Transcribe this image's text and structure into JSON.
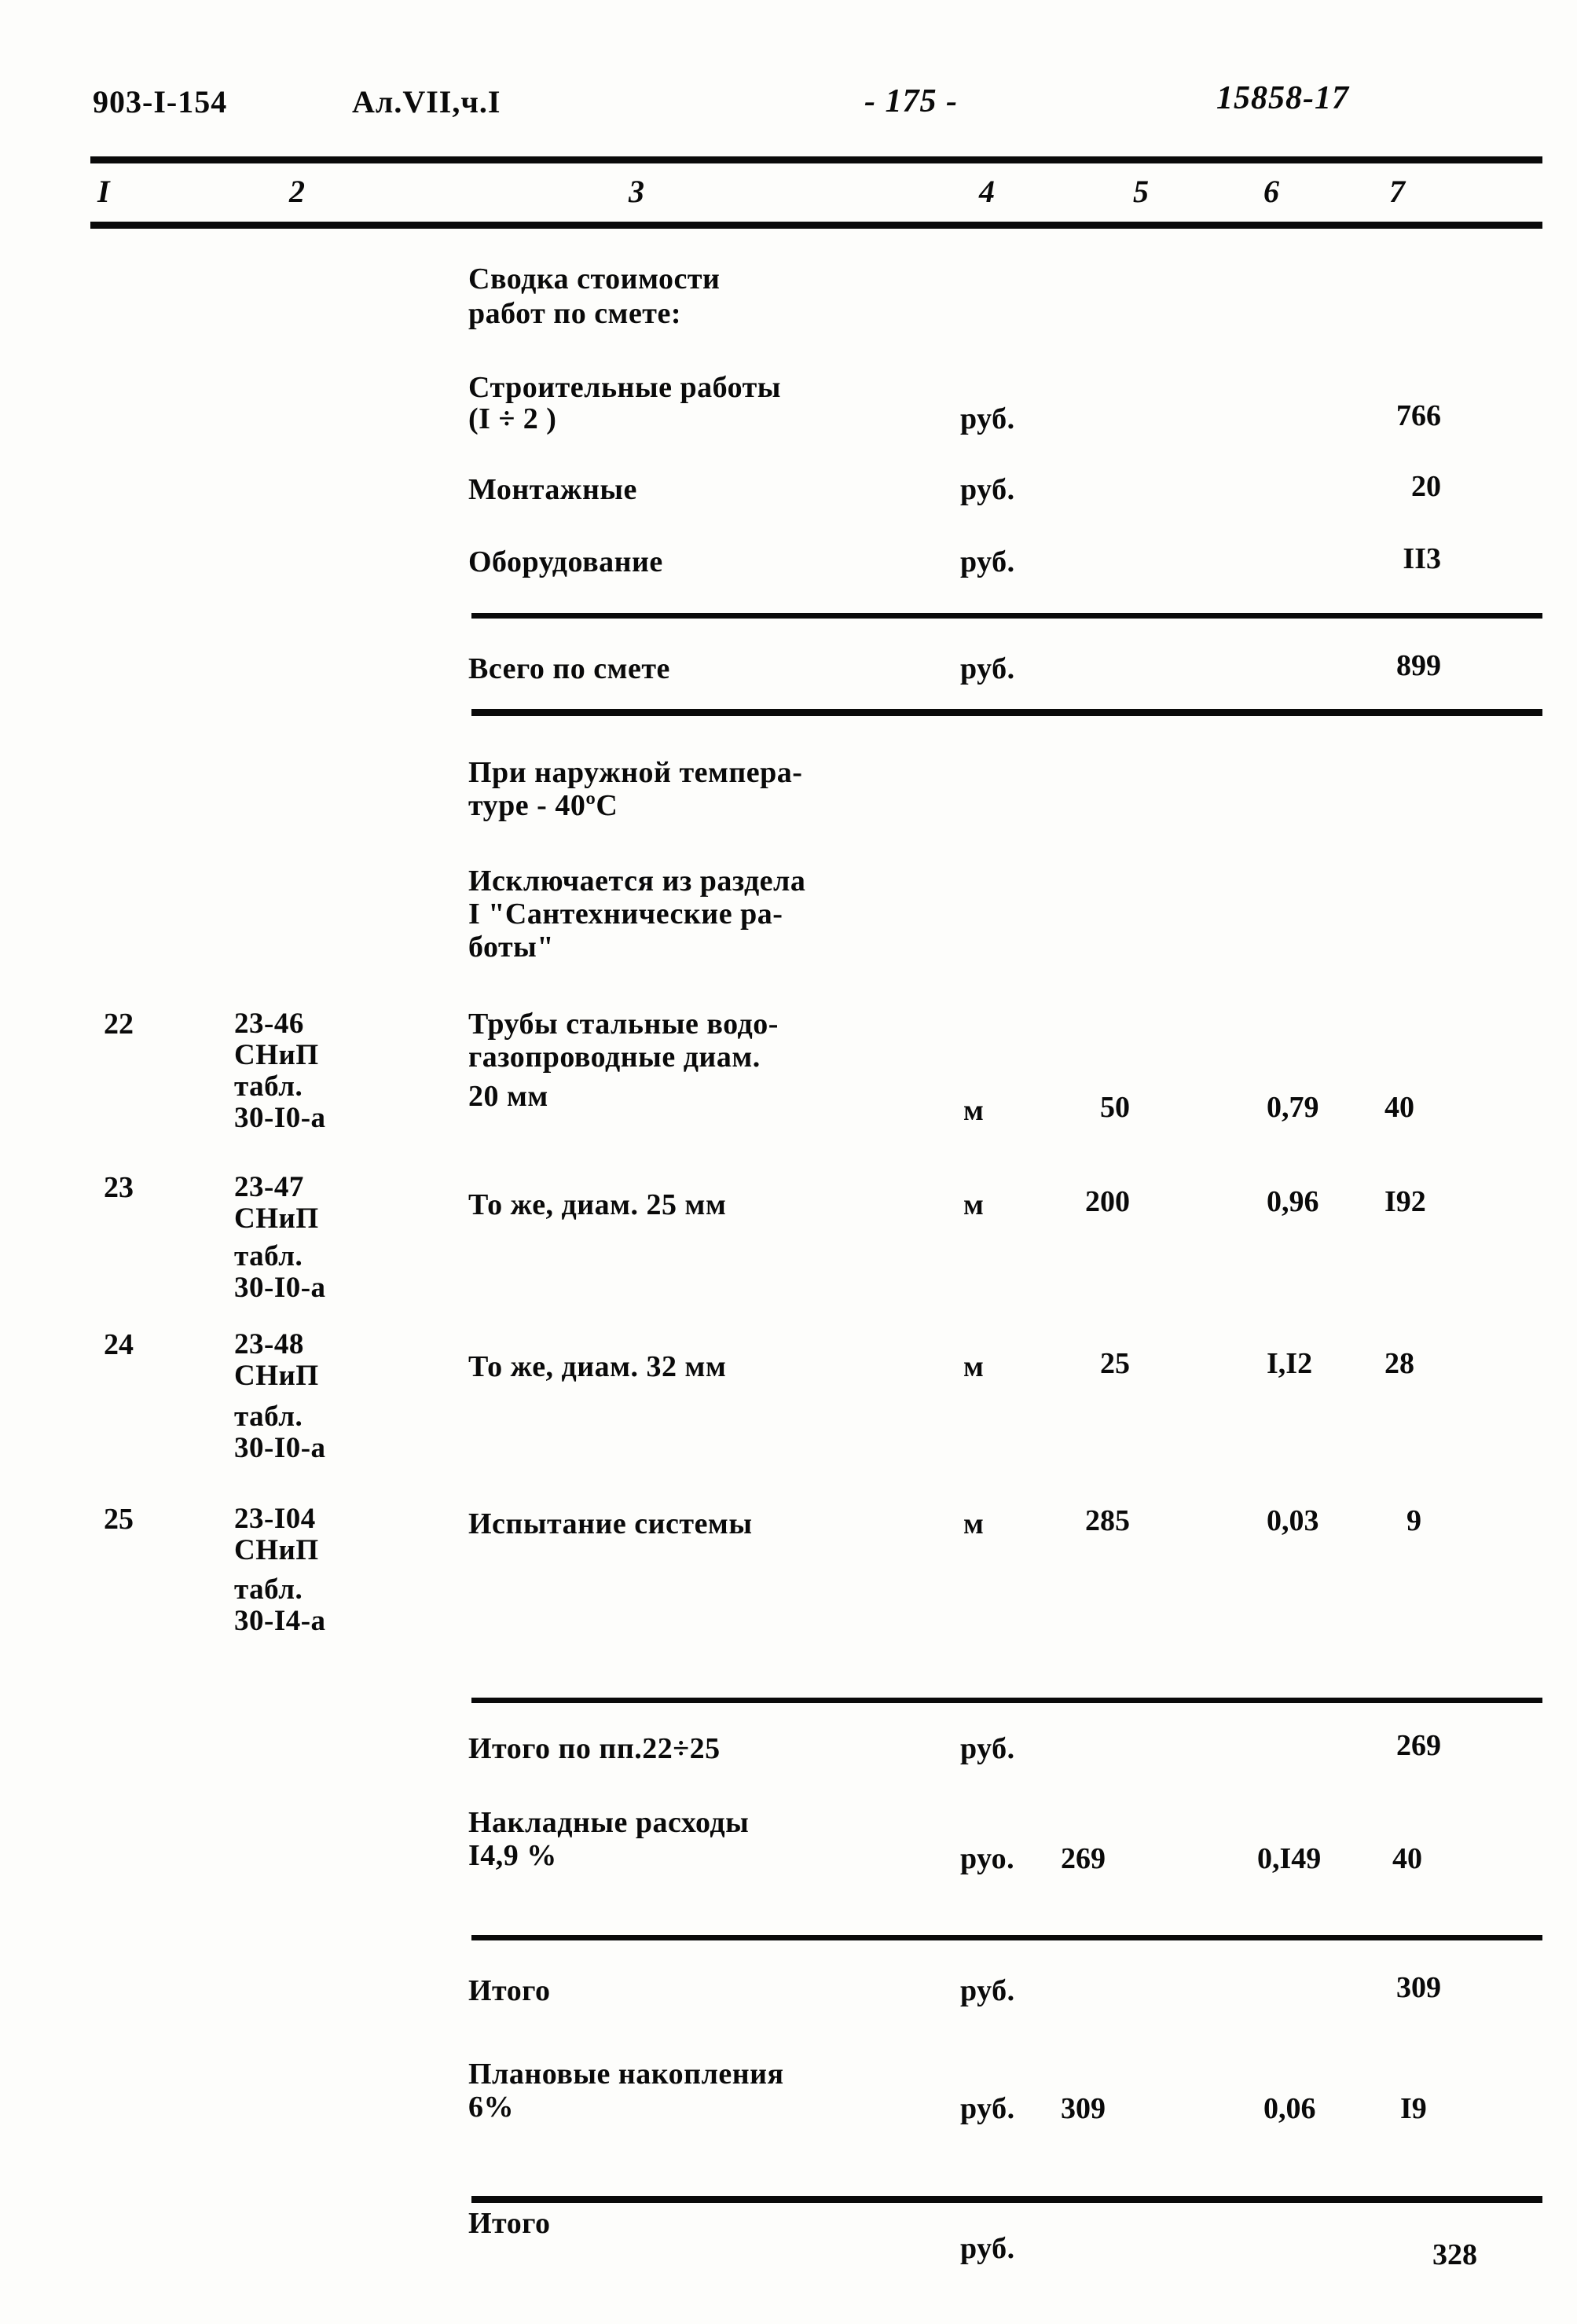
{
  "header": {
    "doc_code": "903-I-154",
    "album": "Ал.VII,ч.I",
    "page_number": "- 175 -",
    "sheet_code": "15858-17"
  },
  "column_headers": [
    "I",
    "2",
    "3",
    "4",
    "5",
    "6",
    "7"
  ],
  "summary_block": {
    "title_line1": "Сводка стоимости",
    "title_line2": "работ по смете:",
    "rows": [
      {
        "label_line1": "Строительные работы",
        "label_line2": "(I ÷ 2 )",
        "unit": "руб.",
        "qty": "",
        "rate": "",
        "amount": "766"
      },
      {
        "label_line1": "Монтажные",
        "label_line2": "",
        "unit": "руб.",
        "qty": "",
        "rate": "",
        "amount": "20"
      },
      {
        "label_line1": "Оборудование",
        "label_line2": "",
        "unit": "руб.",
        "qty": "",
        "rate": "",
        "amount": "II3"
      }
    ],
    "total": {
      "label": "Всего по смете",
      "unit": "руб.",
      "amount": "899"
    }
  },
  "notes": {
    "temperature_line1": "При наружной темпера-",
    "temperature_line2": "туре - 40ºС",
    "exclusion_line1": "Исключается из раздела",
    "exclusion_line2": "I \"Сантехнические ра-",
    "exclusion_line3": "боты\""
  },
  "work_rows": [
    {
      "no": "22",
      "code_line1": "23-46",
      "code_line2": "СНиП",
      "code_line3": "табл.",
      "code_line4": "30-I0-а",
      "desc_line1": "Трубы стальные водо-",
      "desc_line2": "газопроводные диам.",
      "desc_line3": "20 мм",
      "unit": "м",
      "qty": "50",
      "rate": "0,79",
      "amount": "40"
    },
    {
      "no": "23",
      "code_line1": "23-47",
      "code_line2": "СНиП",
      "code_line3": "табл.",
      "code_line4": "30-I0-а",
      "desc_line1": "То же, диам. 25 мм",
      "desc_line2": "",
      "desc_line3": "",
      "unit": "м",
      "qty": "200",
      "rate": "0,96",
      "amount": "I92"
    },
    {
      "no": "24",
      "code_line1": "23-48",
      "code_line2": "СНиП",
      "code_line3": "табл.",
      "code_line4": "30-I0-а",
      "desc_line1": "То же, диам. 32 мм",
      "desc_line2": "",
      "desc_line3": "",
      "unit": "м",
      "qty": "25",
      "rate": "I,I2",
      "amount": "28"
    },
    {
      "no": "25",
      "code_line1": "23-I04",
      "code_line2": "СНиП",
      "code_line3": "табл.",
      "code_line4": "30-I4-а",
      "desc_line1": "Испытание системы",
      "desc_line2": "",
      "desc_line3": "",
      "unit": "м",
      "qty": "285",
      "rate": "0,03",
      "amount": "9"
    }
  ],
  "totals": [
    {
      "label_line1": "Итого по пп.22÷25",
      "label_line2": "",
      "unit": "руб.",
      "qty": "",
      "rate": "",
      "amount": "269"
    },
    {
      "label_line1": "Накладные расходы",
      "label_line2": "I4,9 %",
      "unit": "руо.",
      "qty": "269",
      "rate": "0,I49",
      "amount": "40"
    },
    {
      "label_line1": "Итого",
      "label_line2": "",
      "unit": "руб.",
      "qty": "",
      "rate": "",
      "amount": "309"
    },
    {
      "label_line1": "Плановые накопления",
      "label_line2": "6%",
      "unit": "руб.",
      "qty": "309",
      "rate": "0,06",
      "amount": "I9"
    },
    {
      "label_line1": "Итого",
      "label_line2": "",
      "unit": "руб.",
      "qty": "",
      "rate": "",
      "amount": "328"
    }
  ]
}
